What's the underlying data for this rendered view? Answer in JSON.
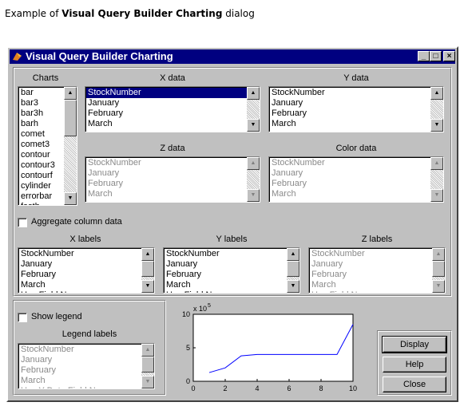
{
  "caption": {
    "prefix": "Example of ",
    "bold": "Visual Query Builder Charting",
    "suffix": " dialog"
  },
  "window": {
    "title": "Visual Query Builder Charting"
  },
  "charts": {
    "label": "Charts",
    "items": [
      "bar",
      "bar3",
      "bar3h",
      "barh",
      "comet",
      "comet3",
      "contour",
      "contour3",
      "contourf",
      "cylinder",
      "errorbar",
      "fastb"
    ]
  },
  "x_data": {
    "label": "X data",
    "items": [
      "StockNumber",
      "January",
      "February",
      "March"
    ],
    "selected": 0
  },
  "y_data": {
    "label": "Y data",
    "items": [
      "StockNumber",
      "January",
      "February",
      "March"
    ]
  },
  "z_data": {
    "label": "Z data",
    "items": [
      "StockNumber",
      "January",
      "February",
      "March"
    ]
  },
  "color_data": {
    "label": "Color data",
    "items": [
      "StockNumber",
      "January",
      "February",
      "March"
    ]
  },
  "aggregate": {
    "label": "Aggregate column data",
    "checked": false
  },
  "x_labels": {
    "label": "X labels",
    "items": [
      "StockNumber",
      "January",
      "February",
      "March",
      "Use Field Names"
    ]
  },
  "y_labels": {
    "label": "Y labels",
    "items": [
      "StockNumber",
      "January",
      "February",
      "March",
      "Use Field Names"
    ]
  },
  "z_labels": {
    "label": "Z labels",
    "items": [
      "StockNumber",
      "January",
      "February",
      "March",
      "Use Field Names"
    ]
  },
  "legend": {
    "show_label": "Show legend",
    "checked": false,
    "labels_label": "Legend labels",
    "items": [
      "StockNumber",
      "January",
      "February",
      "March",
      "Use Y Data Field Names"
    ]
  },
  "buttons": {
    "display": "Display",
    "help": "Help",
    "close": "Close"
  },
  "chart_data": {
    "type": "line",
    "x": [
      1,
      2,
      3,
      4,
      5,
      6,
      7,
      8,
      9,
      10
    ],
    "series": [
      {
        "values": [
          130000,
          200000,
          380000,
          400000,
          400000,
          400000,
          400000,
          400000,
          400000,
          850000
        ]
      }
    ],
    "xlim": [
      0,
      10
    ],
    "ylim": [
      0,
      1000000
    ],
    "xticks": [
      "0",
      "2",
      "4",
      "6",
      "8",
      "10"
    ],
    "yticks": [
      "0",
      "5",
      "10"
    ],
    "exponent": "x 10",
    "exponent_power": "5",
    "line_color": "#0000ff"
  }
}
